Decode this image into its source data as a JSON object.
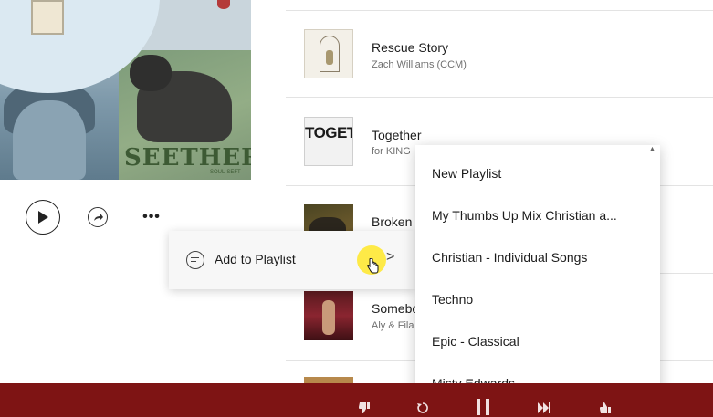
{
  "album_art": {
    "band_text": "SEETHER",
    "band_subtext": "SOUL-SEFT"
  },
  "controls": {
    "play_icon": "play-icon",
    "share_icon": "share-icon",
    "more_label": "•••"
  },
  "tracks": [
    {
      "title": "Rescue Story",
      "artist": "Zach Williams (CCM)"
    },
    {
      "title": "Together",
      "artist": "for KING",
      "thumb_text": "TOGETHER"
    },
    {
      "title": "Broken",
      "artist": ""
    },
    {
      "title": "Somebo",
      "artist": "Aly & Fila"
    }
  ],
  "context_menu": {
    "label": "Add to Playlist",
    "icon": "playlist-icon",
    "chevron": ">"
  },
  "playlists": [
    "New Playlist",
    "My Thumbs Up Mix Christian a...",
    "Christian - Individual Songs",
    "Techno",
    "Epic - Classical",
    "Misty Edwards"
  ],
  "player_bar": {
    "color": "#7e1414",
    "icons": [
      "thumbs-down-icon",
      "replay-icon",
      "pause-icon",
      "skip-icon",
      "thumbs-up-icon"
    ]
  }
}
